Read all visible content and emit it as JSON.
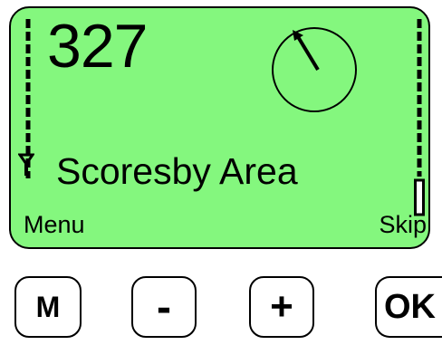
{
  "display": {
    "frequency": "327",
    "station_name": "Scoresby Area",
    "softkey_left": "Menu",
    "softkey_right": "Skip",
    "backlight_color": "#84f77e"
  },
  "icons": {
    "dial": "compass-dial-icon",
    "volume": "volume-bar-icon",
    "antenna": "antenna-icon",
    "signal": "signal-strength-icon"
  },
  "buttons": {
    "menu_label": "M",
    "minus_label": "-",
    "plus_label": "+",
    "ok_label": "OK"
  }
}
